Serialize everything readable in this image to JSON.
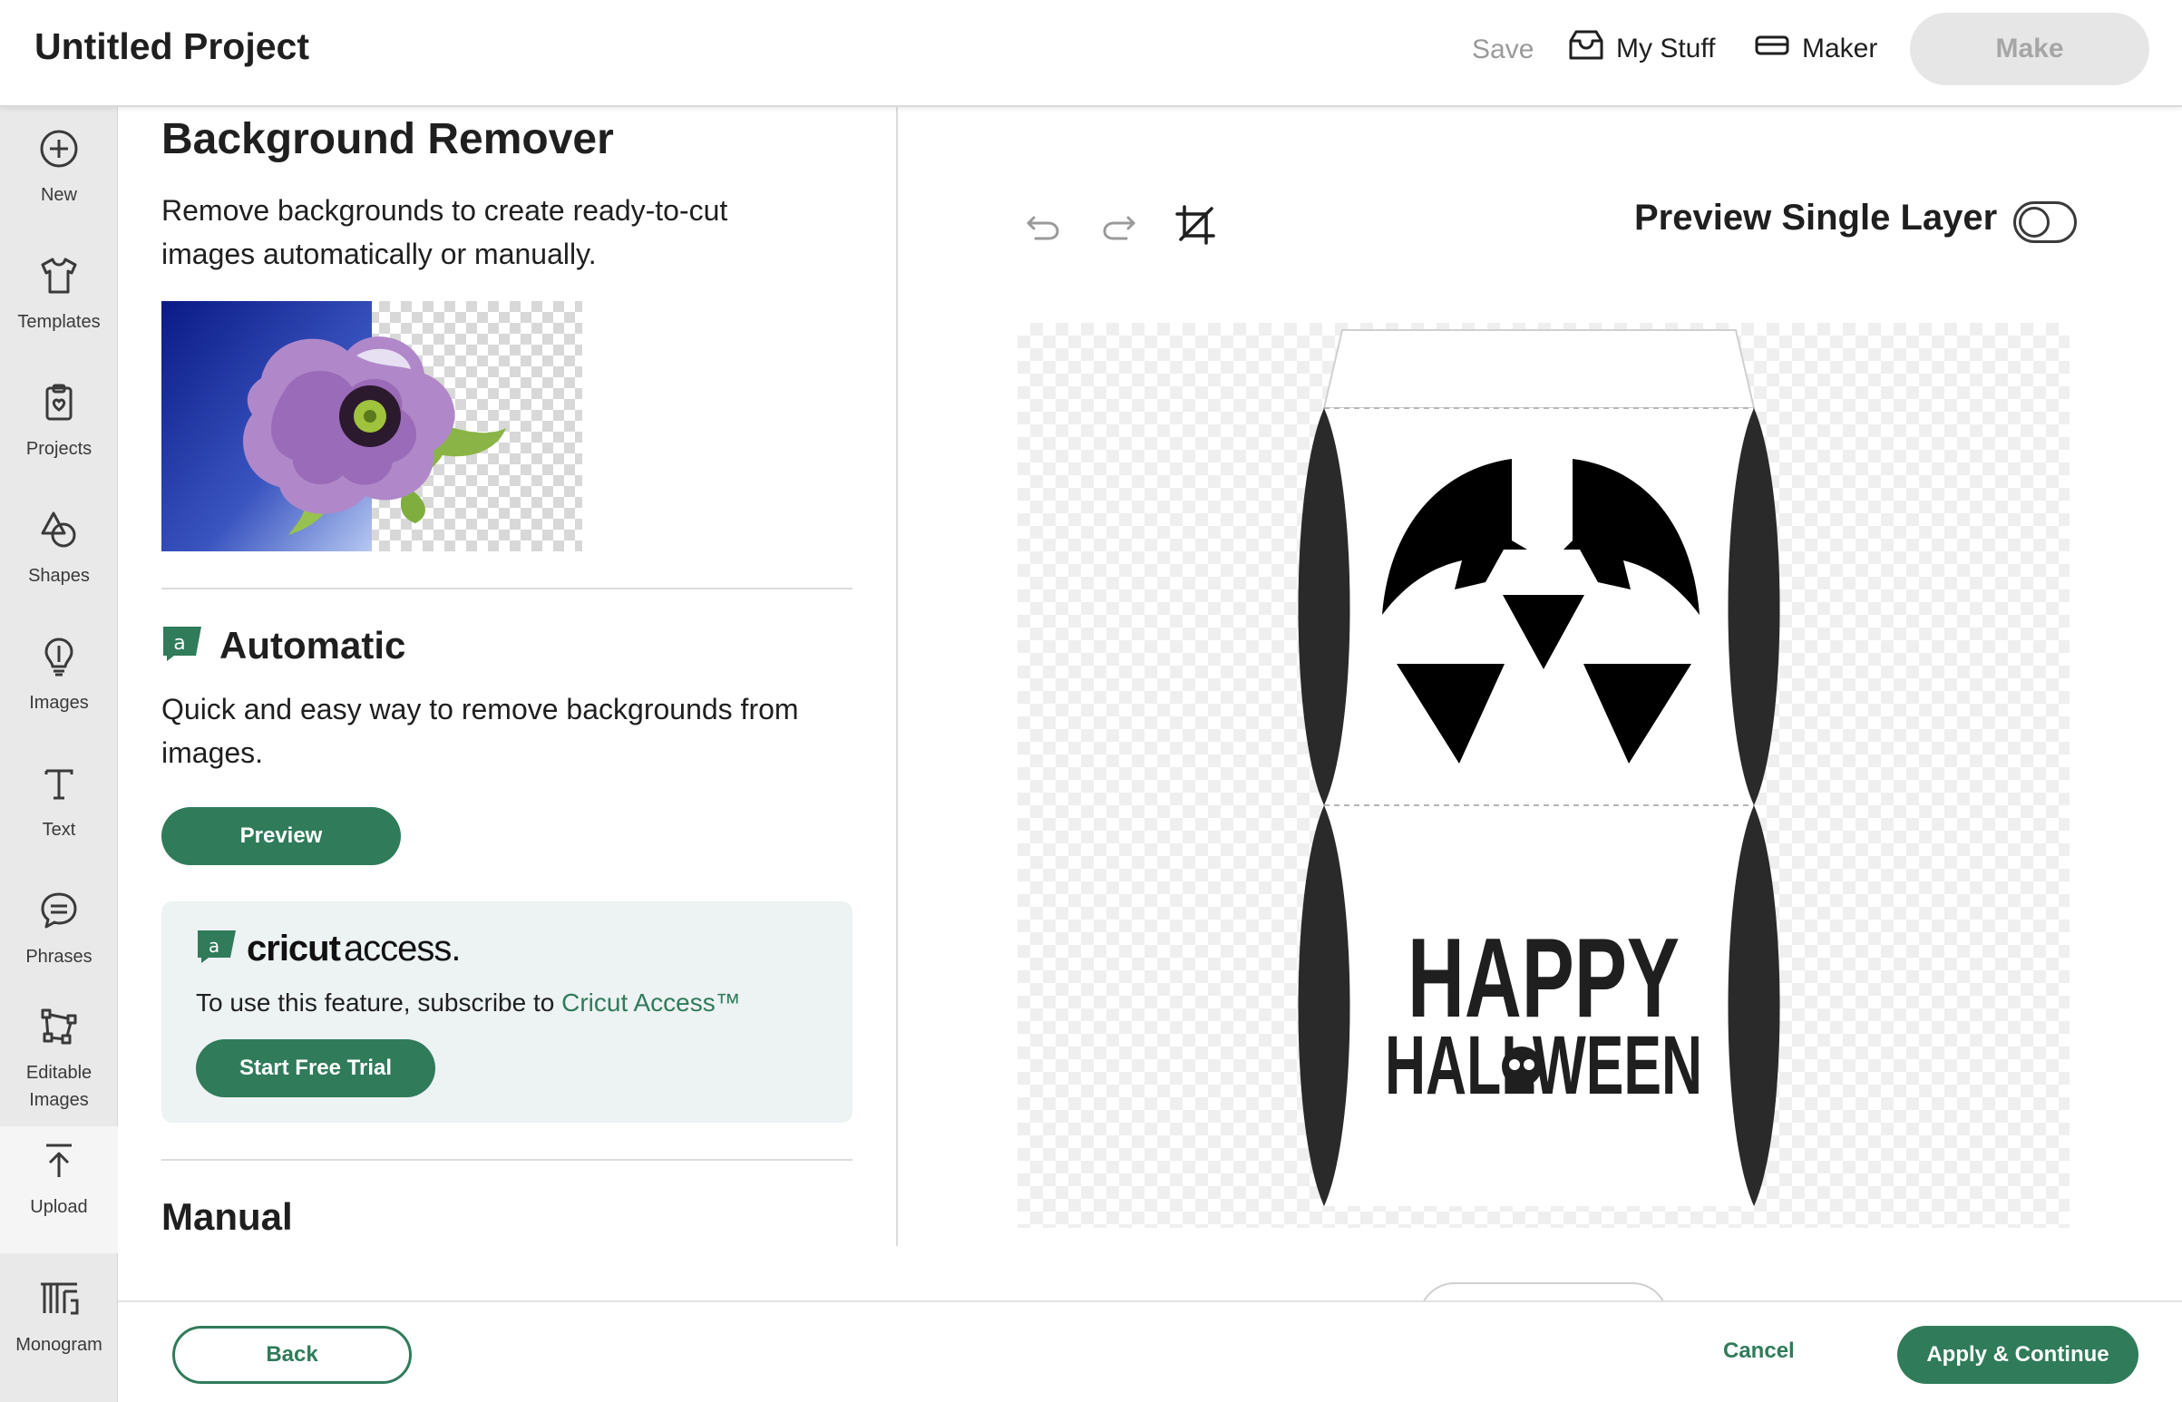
{
  "header": {
    "title": "Untitled Project",
    "save_label": "Save",
    "my_stuff_label": "My Stuff",
    "maker_label": "Maker",
    "make_label": "Make"
  },
  "rail": {
    "items": [
      {
        "label": "New",
        "icon": "plus-circle-icon"
      },
      {
        "label": "Templates",
        "icon": "tshirt-icon"
      },
      {
        "label": "Projects",
        "icon": "clipboard-icon"
      },
      {
        "label": "Shapes",
        "icon": "shapes-icon"
      },
      {
        "label": "Images",
        "icon": "lightbulb-icon"
      },
      {
        "label": "Text",
        "icon": "text-icon"
      },
      {
        "label": "Phrases",
        "icon": "speech-bubble-icon"
      },
      {
        "label": "Editable Images",
        "label_line1": "Editable",
        "label_line2": "Images",
        "icon": "node-edit-icon"
      },
      {
        "label": "Upload",
        "icon": "upload-icon"
      },
      {
        "label": "Monogram",
        "icon": "monogram-icon"
      }
    ]
  },
  "panel": {
    "title": "Background Remover",
    "description": "Remove backgrounds to create ready-to-cut images automatically or manually.",
    "automatic": {
      "title": "Automatic",
      "description": "Quick and easy way to remove backgrounds from images.",
      "preview_label": "Preview"
    },
    "access": {
      "brand_word1": "cricut",
      "brand_word2": "access.",
      "message": "To use this feature, subscribe to ",
      "link": "Cricut Access™",
      "trial_label": "Start Free Trial"
    },
    "manual_title": "Manual"
  },
  "canvas": {
    "preview_single_layer_label": "Preview Single Layer",
    "preview_single_layer_on": false,
    "artwork_text_line1": "HAPPY",
    "artwork_text_line2": "HALLWEEN"
  },
  "footer": {
    "back_label": "Back",
    "cancel_label": "Cancel",
    "apply_label": "Apply & Continue"
  },
  "colors": {
    "accent": "#2f7b5a",
    "rail_bg": "#e9e9e9",
    "access_bg": "#edf2f3"
  }
}
